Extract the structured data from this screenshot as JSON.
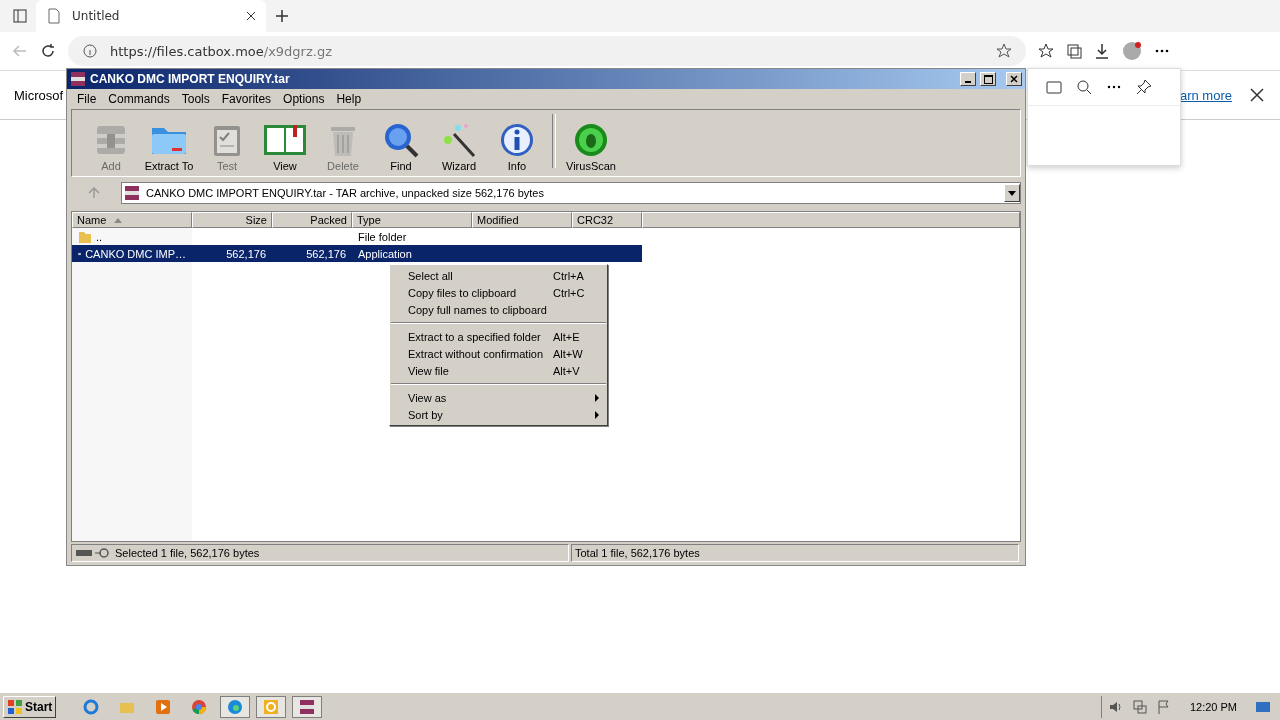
{
  "browser": {
    "tab": {
      "title": "Untitled"
    },
    "url": {
      "host": "https://files.catbox.moe",
      "path": "/x9dgrz.gz"
    },
    "infobar": {
      "text": "Microsof",
      "link": "arn more"
    }
  },
  "window": {
    "title": "CANKO DMC IMPORT ENQUIRY.tar",
    "menu": [
      "File",
      "Commands",
      "Tools",
      "Favorites",
      "Options",
      "Help"
    ],
    "toolbar": [
      {
        "label": "Add",
        "disabled": true,
        "kind": "add"
      },
      {
        "label": "Extract To",
        "disabled": false,
        "kind": "extract"
      },
      {
        "label": "Test",
        "disabled": true,
        "kind": "test"
      },
      {
        "label": "View",
        "disabled": false,
        "kind": "view"
      },
      {
        "label": "Delete",
        "disabled": true,
        "kind": "delete"
      },
      {
        "label": "Find",
        "disabled": false,
        "kind": "find"
      },
      {
        "label": "Wizard",
        "disabled": false,
        "kind": "wizard"
      },
      {
        "label": "Info",
        "disabled": false,
        "kind": "info"
      },
      {
        "label": "VirusScan",
        "disabled": false,
        "kind": "virus"
      }
    ],
    "path": "CANKO DMC IMPORT ENQUIRY.tar - TAR archive, unpacked size 562,176 bytes",
    "columns": [
      {
        "label": "Name",
        "sorted": true
      },
      {
        "label": "Size",
        "sorted": false
      },
      {
        "label": "Packed",
        "sorted": false
      },
      {
        "label": "Type",
        "sorted": false
      },
      {
        "label": "Modified",
        "sorted": false
      },
      {
        "label": "CRC32",
        "sorted": false
      }
    ],
    "rows": [
      {
        "kind": "folder",
        "name": "..",
        "size": "",
        "packed": "",
        "type": "File folder",
        "selected": false
      },
      {
        "kind": "file",
        "name": "CANKO DMC IMP…",
        "size": "562,176",
        "packed": "562,176",
        "type": "Application",
        "selected": true
      }
    ],
    "context_menu": [
      [
        {
          "label": "Select all",
          "shortcut": "Ctrl+A",
          "submenu": false
        },
        {
          "label": "Copy files to clipboard",
          "shortcut": "Ctrl+C",
          "submenu": false
        },
        {
          "label": "Copy full names to clipboard",
          "submenu": false
        }
      ],
      [
        {
          "label": "Extract to a specified folder",
          "shortcut": "Alt+E",
          "submenu": false
        },
        {
          "label": "Extract without confirmation",
          "shortcut": "Alt+W",
          "submenu": false
        },
        {
          "label": "View file",
          "shortcut": "Alt+V",
          "submenu": false
        }
      ],
      [
        {
          "label": "View as",
          "submenu": true
        },
        {
          "label": "Sort by",
          "submenu": true
        }
      ]
    ],
    "status": {
      "left": "Selected 1 file, 562,176 bytes",
      "right": "Total 1 file, 562,176 bytes"
    }
  },
  "taskbar": {
    "start": "Start",
    "clock": "12:20 PM",
    "apps": [
      {
        "kind": "ie",
        "open": false
      },
      {
        "kind": "explorer",
        "open": false
      },
      {
        "kind": "media",
        "open": false
      },
      {
        "kind": "chrome",
        "open": false
      },
      {
        "kind": "edge",
        "open": true
      },
      {
        "kind": "outlook",
        "open": true
      },
      {
        "kind": "winrar",
        "open": true
      }
    ]
  }
}
